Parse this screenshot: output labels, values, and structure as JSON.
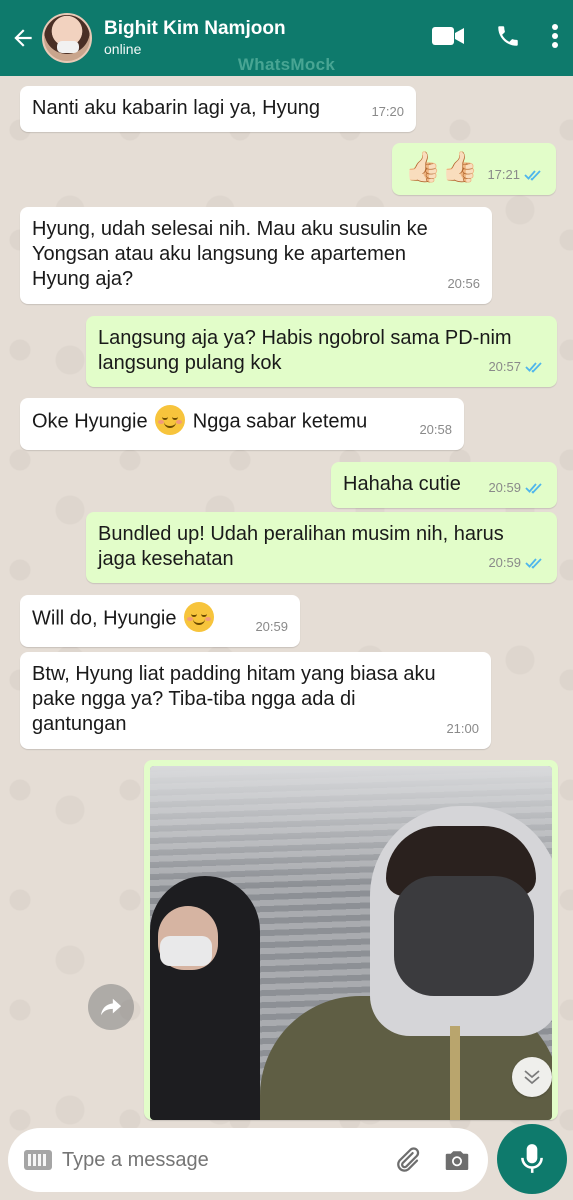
{
  "header": {
    "contact_name": "Bighit Kim Namjoon",
    "status": "online",
    "watermark": "WhatsMock",
    "color": "#0e7a6c"
  },
  "messages": [
    {
      "dir": "in",
      "text": "Nanti aku kabarin lagi ya, Hyung",
      "time": "17:20"
    },
    {
      "dir": "out",
      "text": "👍🏻👍🏻",
      "time": "17:21",
      "read": true
    },
    {
      "dir": "in",
      "text": "Hyung, udah selesai nih. Mau aku susulin ke Yongsan atau aku langsung ke apartemen Hyung aja?",
      "time": "20:56"
    },
    {
      "dir": "out",
      "text": "Langsung aja ya? Habis ngobrol sama PD-nim langsung pulang kok",
      "time": "20:57",
      "read": true
    },
    {
      "dir": "in",
      "text_before": "Oke Hyungie",
      "emoji": "relieved-face",
      "text_after": "Ngga sabar ketemu",
      "time": "20:58"
    },
    {
      "dir": "out",
      "text": "Hahaha cutie",
      "time": "20:59",
      "read": true
    },
    {
      "dir": "out",
      "text": "Bundled up! Udah peralihan musim nih, harus jaga kesehatan",
      "time": "20:59",
      "read": true
    },
    {
      "dir": "in",
      "text": "Will do, Hyungie",
      "emoji": "relieved-face",
      "time": "20:59"
    },
    {
      "dir": "in",
      "text": "Btw, Hyung liat padding hitam yang biasa aku pake ngga ya? Tiba-tiba ngga ada di gantungan",
      "time": "21:00"
    },
    {
      "dir": "out",
      "type": "photo",
      "description_icon": "selfie-photo"
    }
  ],
  "input": {
    "placeholder": "Type a message"
  },
  "icons": {
    "back": "back-arrow-icon",
    "video": "video-call-icon",
    "call": "phone-icon",
    "menu": "more-vert-icon",
    "attach": "paperclip-icon",
    "camera": "camera-icon",
    "mic": "mic-icon",
    "forward": "forward-icon",
    "scroll": "chevron-down-icon"
  },
  "colors": {
    "incoming_bubble": "#ffffff",
    "outgoing_bubble": "#e2fdc9",
    "read_tick": "#4fb6ec"
  }
}
